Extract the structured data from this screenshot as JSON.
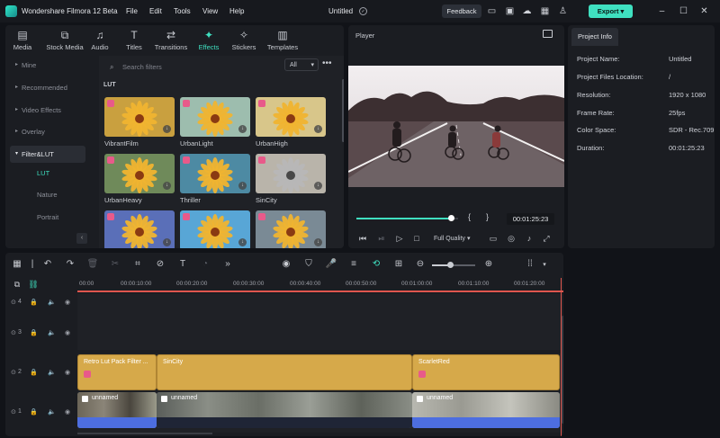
{
  "titlebar": {
    "app_name": "Wondershare Filmora 12 Beta",
    "menus": [
      "File",
      "Edit",
      "Tools",
      "View",
      "Help"
    ],
    "project_name": "Untitled",
    "feedback_label": "Feedback",
    "export_label": "Export"
  },
  "library": {
    "tabs": [
      {
        "label": "Media",
        "icon": "folder-icon"
      },
      {
        "label": "Stock Media",
        "icon": "stock-icon"
      },
      {
        "label": "Audio",
        "icon": "music-icon"
      },
      {
        "label": "Titles",
        "icon": "title-icon"
      },
      {
        "label": "Transitions",
        "icon": "transition-icon"
      },
      {
        "label": "Effects",
        "icon": "effects-icon"
      },
      {
        "label": "Stickers",
        "icon": "sticker-icon"
      },
      {
        "label": "Templates",
        "icon": "template-icon"
      }
    ],
    "active_tab": "Effects",
    "sidebar": [
      {
        "label": "Mine"
      },
      {
        "label": "Recommended"
      },
      {
        "label": "Video Effects"
      },
      {
        "label": "Overlay"
      },
      {
        "label": "Filter&LUT"
      }
    ],
    "sub_items": [
      "LUT",
      "Nature",
      "Portrait"
    ],
    "search_placeholder": "Search filters",
    "filter_select": "All",
    "section_label": "LUT",
    "thumbnails": [
      {
        "name": "VibrantFilm",
        "tint": "#c9a03f"
      },
      {
        "name": "UrbanLight",
        "tint": "#9dbdae"
      },
      {
        "name": "UrbanHigh",
        "tint": "#d8c68a"
      },
      {
        "name": "UrbanHeavy",
        "tint": "#6f8a5a"
      },
      {
        "name": "Thriller",
        "tint": "#4d8aa3"
      },
      {
        "name": "SinCity",
        "tint": "#b9b4aa"
      },
      {
        "name": "",
        "tint": "#5a6fb8"
      },
      {
        "name": "",
        "tint": "#58a6d6"
      },
      {
        "name": "",
        "tint": "#7a8a95"
      }
    ]
  },
  "player": {
    "title": "Player",
    "timecode": "00:01:25:23",
    "quality": "Full Quality",
    "progress": 0.93
  },
  "project_info": {
    "tab_label": "Project Info",
    "rows": [
      {
        "label": "Project Name:",
        "value": "Untitled"
      },
      {
        "label": "Project Files Location:",
        "value": "/"
      },
      {
        "label": "Resolution:",
        "value": "1920 x 1080"
      },
      {
        "label": "Frame Rate:",
        "value": "25fps"
      },
      {
        "label": "Color Space:",
        "value": "SDR - Rec.709"
      },
      {
        "label": "Duration:",
        "value": "00:01:25:23"
      }
    ]
  },
  "timeline": {
    "ruler_labels": [
      "00:00",
      "00:00:10:00",
      "00:00:20:00",
      "00:00:30:00",
      "00:00:40:00",
      "00:00:50:00",
      "00:01:00:00",
      "00:01:10:00",
      "00:01:20:00"
    ],
    "tracks": [
      {
        "num": "4"
      },
      {
        "num": "3"
      },
      {
        "num": "2"
      },
      {
        "num": "1"
      }
    ],
    "effect_clips": [
      {
        "label": "Retro Lut Pack Filter ..."
      },
      {
        "label": "SinCity"
      },
      {
        "label": "ScarletRed"
      }
    ],
    "video_clips": [
      {
        "label": "unnamed"
      },
      {
        "label": "unnamed"
      },
      {
        "label": "unnamed"
      }
    ]
  },
  "colors": {
    "accent": "#3fe0c0",
    "effect_clip": "#d6a94a",
    "audio": "#4d6ee0",
    "playhead": "#e0564e"
  }
}
